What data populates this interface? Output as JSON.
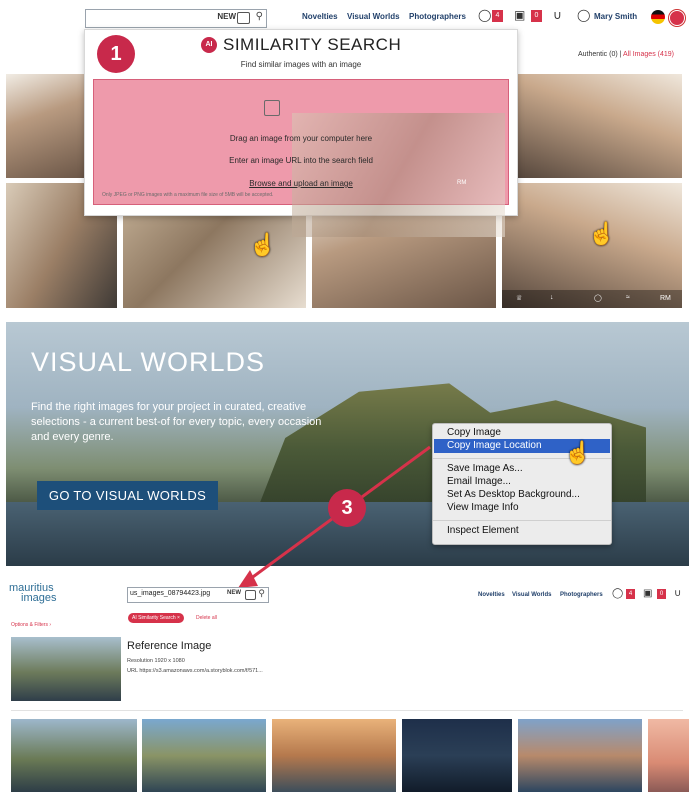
{
  "panel1": {
    "search": {
      "new_label": "NEW"
    },
    "nav": {
      "novelties": "Novelties",
      "visual_worlds": "Visual Worlds",
      "photographers": "Photographers",
      "lightbox_count": "4",
      "cart_count": "0",
      "user": "Mary Smith"
    },
    "strip": {
      "authentic": "Authentic (0) |",
      "all": "All Images (419)"
    },
    "step_number": "1",
    "modal": {
      "ai_badge": "AI",
      "title": "SIMILARITY SEARCH",
      "subtitle": "Find similar images with an image",
      "drag": "Drag an image from your computer here",
      "enter_url": "Enter an image URL into the search field",
      "browse": "Browse and upload an image",
      "footnote": "Only JPEG or PNG images with a maximum file size of 5MB will be accepted.",
      "rm": "RM"
    },
    "tile_rm": "RM"
  },
  "panel2": {
    "title": "VISUAL WORLDS",
    "text": "Find the right images for your project in curated, creative selections - a current best-of for every topic, every occasion and every genre.",
    "button": "GO TO VISUAL WORLDS",
    "step_number": "3",
    "context_menu": [
      "Copy Image",
      "Copy Image Location",
      "Save Image As...",
      "Email Image...",
      "Set As Desktop Background...",
      "View Image Info",
      "Inspect Element"
    ]
  },
  "panel3": {
    "logo_line1": "mauritius",
    "logo_line2": "images",
    "search_value": "us_images_08794423.jpg",
    "new_label": "NEW",
    "nav": {
      "novelties": "Novelties",
      "visual_worlds": "Visual Worlds",
      "photographers": "Photographers",
      "lightbox_count": "4",
      "cart_count": "0"
    },
    "options": "Options & Filters ›",
    "chip": "AI Similarity Search ×",
    "delete_all": "Delete all",
    "ref_title": "Reference Image",
    "resolution": "Resolution 1920 x 1080",
    "url": "URL https://s3.amazonaws.com/a.storyblok.com/f/571..."
  },
  "colors": {
    "accent": "#d6324a",
    "step_badge": "#c8294b",
    "dropzone": "#ee9aab",
    "nav_text": "#22416b",
    "hero_button": "#1d4f7a",
    "menu_highlight": "#2f62c7"
  },
  "icons": [
    "camera-icon",
    "search-icon",
    "lightbulb-icon",
    "lightbox-icon",
    "cart-icon",
    "headset-icon",
    "user-icon",
    "flag-de-icon",
    "flag-uk-icon",
    "upload-icon",
    "pointer-hand-icon",
    "arrow-icon"
  ]
}
